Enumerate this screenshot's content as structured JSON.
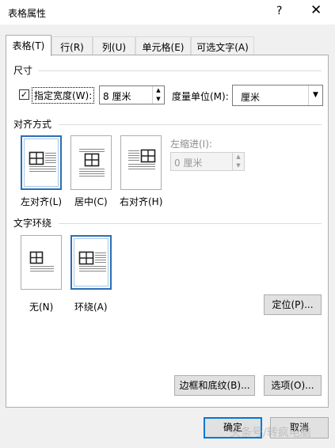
{
  "window": {
    "title": "表格属性",
    "help_icon": "?",
    "close_icon": "✕"
  },
  "tabs": [
    {
      "label": "表格(T)",
      "active": true
    },
    {
      "label": "行(R)",
      "active": false
    },
    {
      "label": "列(U)",
      "active": false
    },
    {
      "label": "单元格(E)",
      "active": false
    },
    {
      "label": "可选文字(A)",
      "active": false
    }
  ],
  "size": {
    "section_label": "尺寸",
    "preferred_width_checked": true,
    "preferred_width_label": "指定宽度(W):",
    "preferred_width_value": "8 厘米",
    "measure_label": "度量单位(M):",
    "measure_value": "厘米"
  },
  "alignment": {
    "section_label": "对齐方式",
    "options": [
      {
        "label": "左对齐(L)",
        "selected": true
      },
      {
        "label": "居中(C)",
        "selected": false
      },
      {
        "label": "右对齐(H)",
        "selected": false
      }
    ],
    "indent_label": "左缩进(I):",
    "indent_value": "0 厘米"
  },
  "wrapping": {
    "section_label": "文字环绕",
    "options": [
      {
        "label": "无(N)",
        "selected": false
      },
      {
        "label": "环绕(A)",
        "selected": true
      }
    ],
    "positioning_button": "定位(P)..."
  },
  "buttons": {
    "borders_shading": "边框和底纹(B)...",
    "options": "选项(O)...",
    "ok": "确定",
    "cancel": "取消"
  },
  "watermark": "头条号/转疯电脑",
  "colors": {
    "accent": "#2a6fb3",
    "default_button_border": "#0078d7"
  }
}
